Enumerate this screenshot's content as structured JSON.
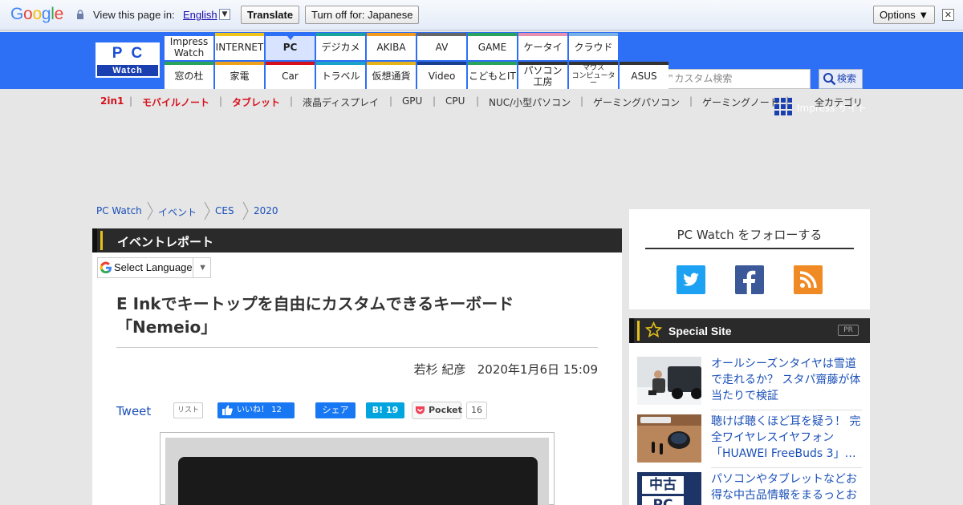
{
  "translate_bar": {
    "logo": "Google",
    "view_label": "View this page in:",
    "language": "English",
    "translate_button": "Translate",
    "turn_off_button": "Turn off for: Japanese",
    "options_button": "Options ▼",
    "close_symbol": "✕"
  },
  "header": {
    "logo_top": [
      "P",
      "C"
    ],
    "logo_bottom": "Watch",
    "nav_top": [
      {
        "label": "Impress\nWatch",
        "color": "#2d6ff5"
      },
      {
        "label": "INTERNET",
        "color": "#f0c419"
      },
      {
        "label": "PC",
        "color": "#2d6ff5"
      },
      {
        "label": "デジカメ",
        "color": "#1aa39b"
      },
      {
        "label": "AKIBA",
        "color": "#f29a1b"
      },
      {
        "label": "AV",
        "color": "#666666"
      },
      {
        "label": "GAME",
        "color": "#2aa35a"
      },
      {
        "label": "ケータイ",
        "color": "#e88fb0"
      },
      {
        "label": "クラウド",
        "color": "#7ab0e8"
      }
    ],
    "nav_bottom": [
      {
        "label": "窓の杜",
        "color": "#2aa35a"
      },
      {
        "label": "家電",
        "color": "#f0a21b"
      },
      {
        "label": "Car",
        "color": "#d6101b"
      },
      {
        "label": "トラベル",
        "color": "#1aa3c9"
      },
      {
        "label": "仮想通貨",
        "color": "#e8b21b"
      },
      {
        "label": "Video",
        "color": "#1a3f8f"
      },
      {
        "label": "こどもとIT",
        "color": "#2aa35a"
      },
      {
        "label": "パソコン\n工房",
        "color": "#333333"
      },
      {
        "label": "マウス\nコンピューター",
        "color": "#333333"
      },
      {
        "label": "ASUS",
        "color": "#333333"
      }
    ],
    "search_placeholder": "Google™カスタム検索",
    "search_button": "検索",
    "impress_link": "Impress サイト"
  },
  "categories": {
    "items": [
      "2in1",
      "モバイルノート",
      "タブレット",
      "液晶ディスプレイ",
      "GPU",
      "CPU",
      "NUC/小型パソコン",
      "ゲーミングパソコン",
      "ゲーミングノート"
    ],
    "all_label": "全カテゴリ"
  },
  "breadcrumb": [
    "PC Watch",
    "イベント",
    "CES",
    "2020"
  ],
  "article": {
    "section": "イベントレポート",
    "select_language": "Select Language",
    "select_language_caret": "▼",
    "headline_line1": "E Inkでキートップを自由にカスタムできるキーボード",
    "headline_line2": "「Nemeio」",
    "author": "若杉 紀彦",
    "date": "2020年1月6日 15:09",
    "tweet": "Tweet",
    "list": "リスト",
    "fb_like": "いいね！ 12",
    "share": "シェア",
    "hatena": "B! 19",
    "pocket": "Pocket",
    "pocket_count": "16"
  },
  "sidebar": {
    "follow_title": "PC Watch をフォローする",
    "special_title": "Special Site",
    "special_pr": "PR",
    "special_items": [
      "オールシーズンタイヤは雪道で走れるか？ スタパ齋藤が体当たりで検証",
      "聴けば聴くほど耳を疑う！ 完全ワイヤレスイヤフォン「HUAWEI FreeBuds 3」…",
      "パソコンやタブレットなどお得な中古品情報をまるっとお"
    ],
    "thumb3_text": [
      "中古",
      "PC"
    ]
  },
  "colors": {
    "header_blue": "#2d6ff5",
    "link_blue": "#1a4fb8",
    "accent_red": "#d6101b",
    "twitter": "#1da1f2",
    "facebook": "#3b5998",
    "rss": "#f08a24"
  }
}
